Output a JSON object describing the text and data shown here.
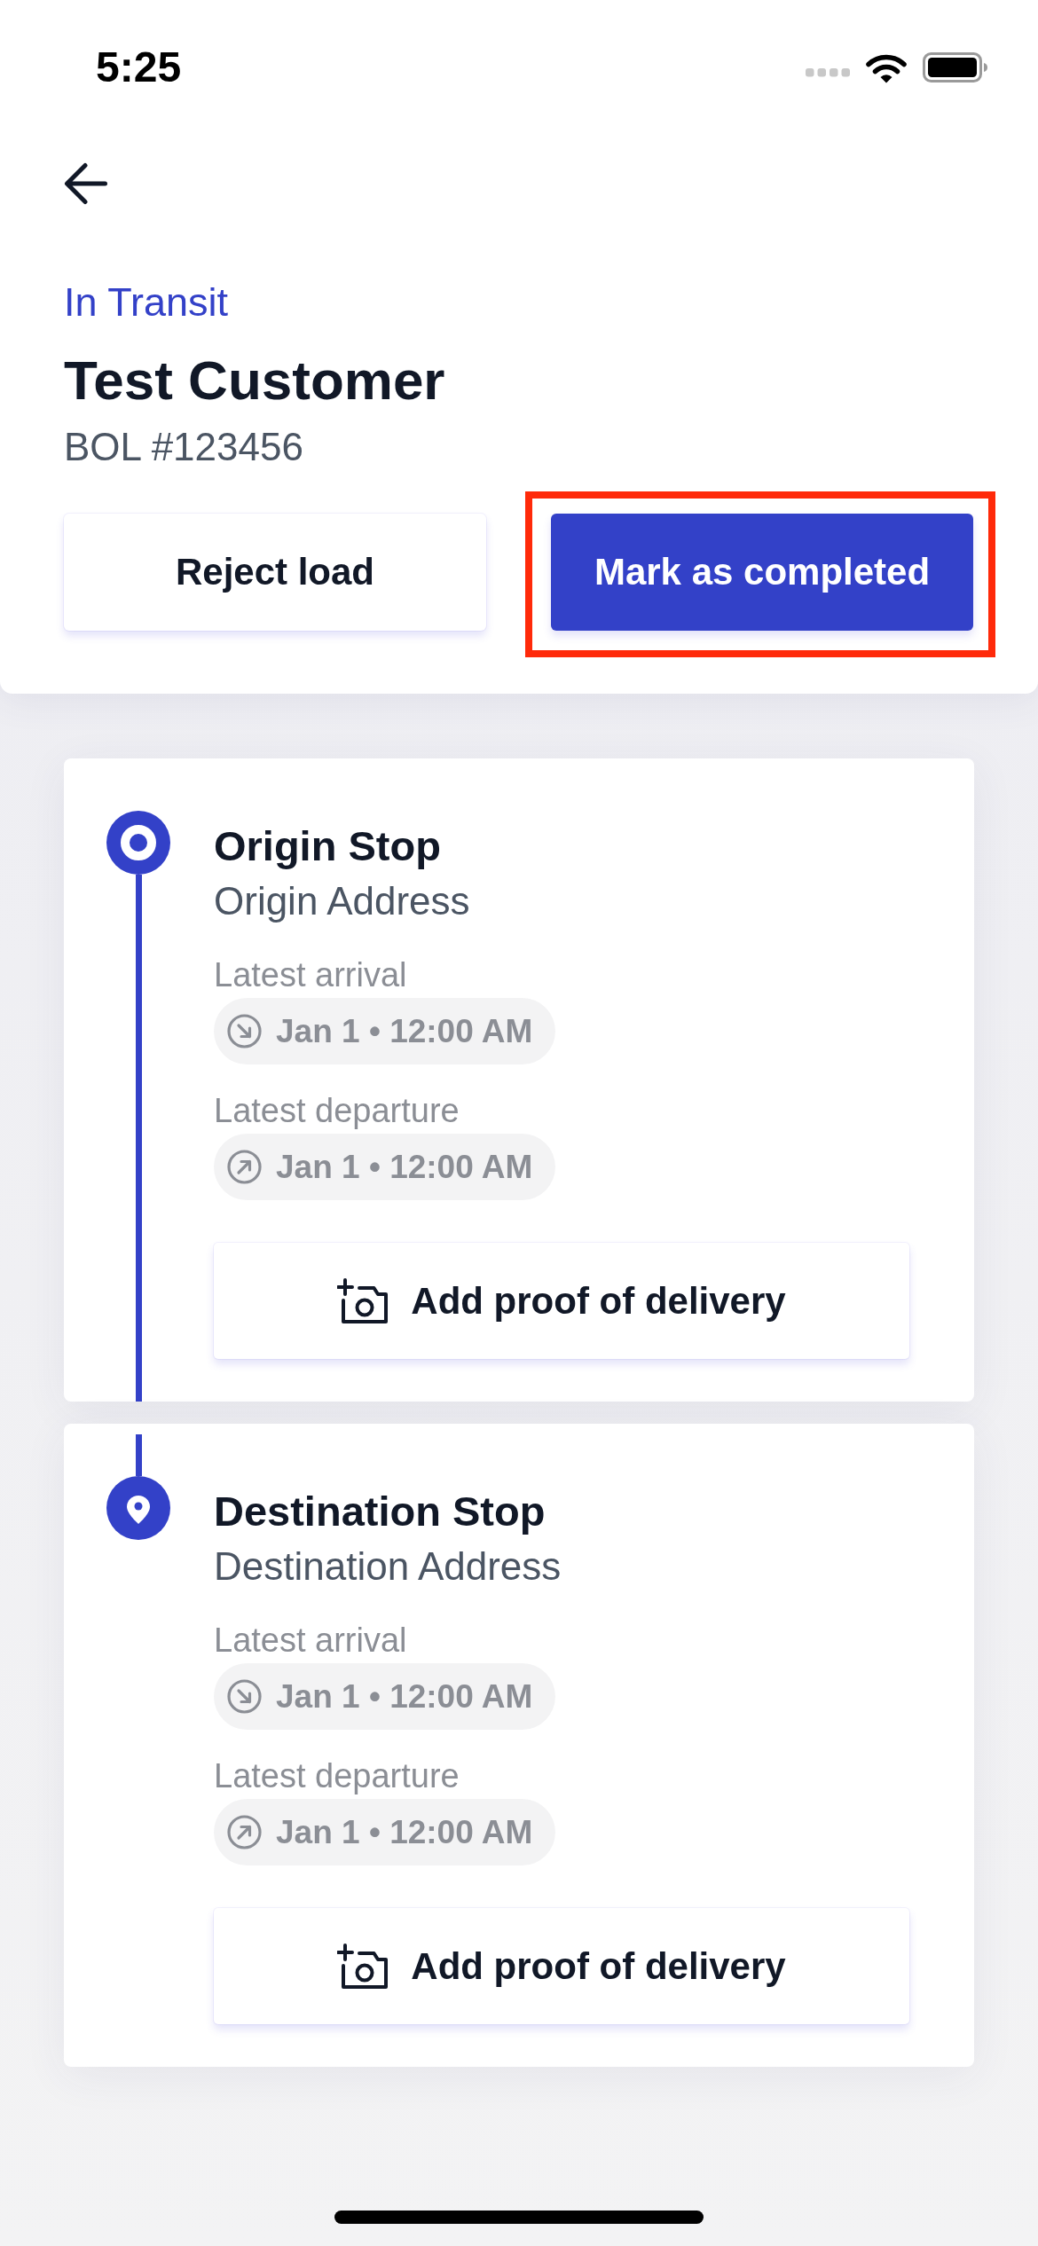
{
  "status_bar": {
    "time": "5:25"
  },
  "header": {
    "status": "In Transit",
    "customer": "Test Customer",
    "reference": "BOL #123456",
    "actions": [
      {
        "label": "Reject load",
        "kind": "secondary",
        "highlighted": false
      },
      {
        "label": "Mark as completed",
        "kind": "primary",
        "highlighted": true
      }
    ]
  },
  "stops": [
    {
      "kind": "origin",
      "title": "Origin Stop",
      "address": "Origin Address",
      "times": [
        {
          "kind": "arrival",
          "label": "Latest arrival",
          "value": "Jan 1 • 12:00 AM"
        },
        {
          "kind": "departure",
          "label": "Latest departure",
          "value": "Jan 1 • 12:00 AM"
        }
      ],
      "action": "Add proof of delivery"
    },
    {
      "kind": "destination",
      "title": "Destination Stop",
      "address": "Destination Address",
      "times": [
        {
          "kind": "arrival",
          "label": "Latest arrival",
          "value": "Jan 1 • 12:00 AM"
        },
        {
          "kind": "departure",
          "label": "Latest departure",
          "value": "Jan 1 • 12:00 AM"
        }
      ],
      "action": "Add proof of delivery"
    }
  ]
}
